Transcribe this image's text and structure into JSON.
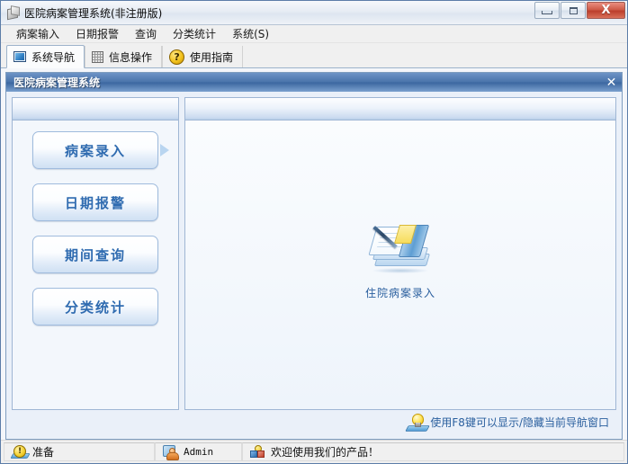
{
  "window": {
    "title": "医院病案管理系统(非注册版)",
    "app_icon": "app-cube-icon",
    "controls": {
      "minimize": "minimize-button",
      "restore": "restore-button",
      "close": "close-button",
      "close_glyph": "X"
    }
  },
  "menubar": {
    "items": [
      {
        "label": "病案输入"
      },
      {
        "label": "日期报警"
      },
      {
        "label": "查询"
      },
      {
        "label": "分类统计"
      },
      {
        "label": "系统(S)"
      }
    ]
  },
  "tabs": [
    {
      "label": "系统导航",
      "icon": "monitor-icon",
      "active": true
    },
    {
      "label": "信息操作",
      "icon": "grid-icon",
      "active": false
    },
    {
      "label": "使用指南",
      "icon": "help-question-icon",
      "active": false
    }
  ],
  "mdi_window": {
    "title": "医院病案管理系统",
    "close_glyph": "✕"
  },
  "navigation": {
    "buttons": [
      {
        "label": "病案录入",
        "selected": true
      },
      {
        "label": "日期报警",
        "selected": false
      },
      {
        "label": "期间查询",
        "selected": false
      },
      {
        "label": "分类统计",
        "selected": false
      }
    ]
  },
  "content": {
    "shortcuts": [
      {
        "label": "住院病案录入",
        "icon": "notebook-pen-icon"
      }
    ],
    "hint": {
      "icon": "lightbulb-icon",
      "text": "使用F8键可以显示/隐藏当前导航窗口"
    }
  },
  "statusbar": {
    "ready": {
      "icon": "warning-icon",
      "text": "准备"
    },
    "user": {
      "icon": "user-icon",
      "text": "Admin"
    },
    "message": {
      "icon": "blocks-icon",
      "text": "欢迎使用我们的产品！"
    }
  },
  "colors": {
    "accent": "#2f6bb0",
    "caption_blue": "#4a74ab",
    "close_red": "#cf5b48",
    "panel_bg": "#eaf0f9"
  }
}
